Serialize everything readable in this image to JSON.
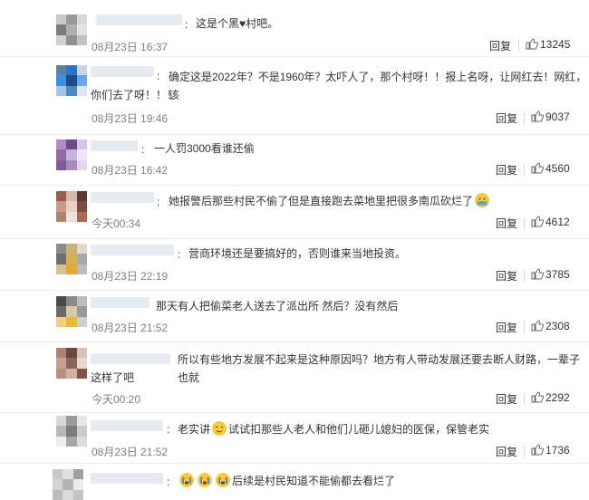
{
  "comments": [
    {
      "text": "这是个黑",
      "text_after": "村吧。",
      "time": "08月23日 16:37",
      "reply": "回复",
      "likes": "13245"
    },
    {
      "text": "确定这是2022年？不是1960年？太吓人了，那个村呀！！报上名呀，让网红去！网红，该",
      "text2": "你们去了呀！！！",
      "time": "08月23日 19:46",
      "reply": "回复",
      "likes": "9037"
    },
    {
      "text": "一人罚3000看谁还偷",
      "time": "08月23日 16:42",
      "reply": "回复",
      "likes": "4560"
    },
    {
      "text": "她报警后那些村民不偷了但是直接跑去菜地里把很多南瓜砍烂了",
      "time": "今天00:34",
      "reply": "回复",
      "likes": "4612"
    },
    {
      "text": "营商环境还是要搞好的，否则谁来当地投资。",
      "time": "08月23日 22:19",
      "reply": "回复",
      "likes": "3785"
    },
    {
      "text": "那天有人把偷菜老人送去了派出所 然后？没有然后",
      "time": "08月23日 21:52",
      "reply": "回复",
      "likes": "2308"
    },
    {
      "text": "所以有些地方发展不起来是这种原因吗？地方有人带动发展还要去断人财路，一辈子也就",
      "text2": "这样了吧",
      "time": "今天00:20",
      "reply": "回复",
      "likes": "2292"
    },
    {
      "text": "老实讲",
      "text_after": "试试扣那些人老人和他们儿砸儿媳妇的医保，保管老实",
      "time": "08月23日 21:52",
      "reply": "回复",
      "likes": "1736"
    },
    {
      "text": "后续是村民知道不能偷都去看烂了"
    }
  ],
  "colors": {
    "emoji": "#f7c843",
    "like_icon": "#666666"
  }
}
